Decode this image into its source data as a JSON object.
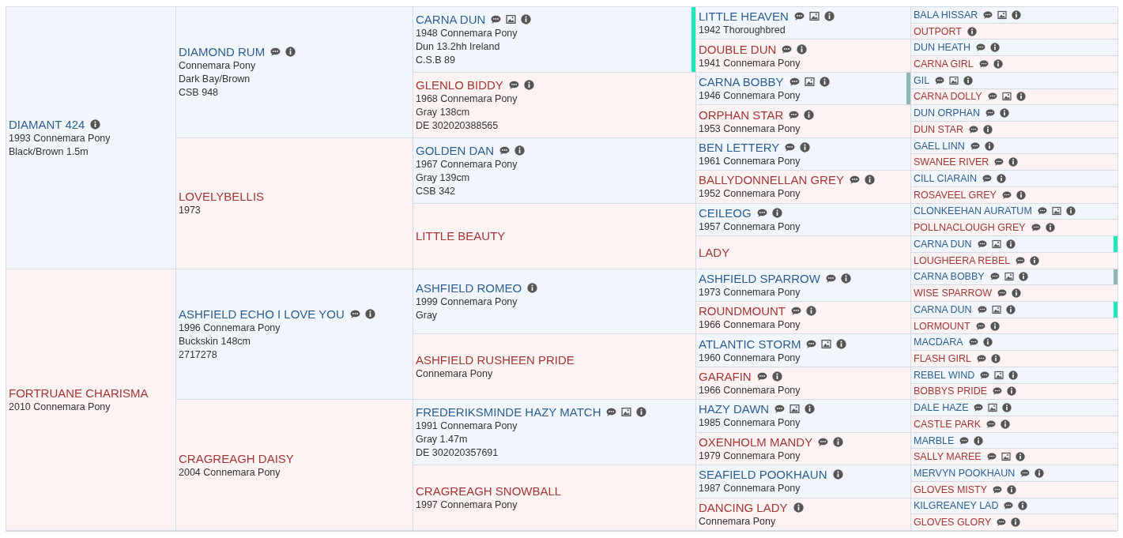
{
  "pedigree": [
    {
      "name": "DIAMANT 424",
      "kind": "sire",
      "details": [
        "1993 Connemara Pony",
        "Black/Brown 1.5m"
      ],
      "comment": false,
      "photo": false,
      "info": true,
      "parents": [
        {
          "name": "DIAMOND RUM",
          "kind": "sire",
          "details": [
            "Connemara Pony",
            "Dark Bay/Brown",
            "CSB 948"
          ],
          "comment": true,
          "photo": false,
          "info": true,
          "parents": [
            {
              "name": "CARNA DUN",
              "kind": "sire",
              "details": [
                "1948 Connemara Pony",
                "Dun 13.2hh Ireland",
                "C.S.B 89"
              ],
              "comment": true,
              "photo": true,
              "info": true,
              "color": "#1de9b6",
              "parents": [
                {
                  "name": "LITTLE HEAVEN",
                  "kind": "sire",
                  "details": [
                    "1942 Thoroughbred"
                  ],
                  "comment": true,
                  "photo": true,
                  "info": true,
                  "parents": [
                    {
                      "name": "BALA HISSAR",
                      "kind": "sire",
                      "comment": true,
                      "photo": true,
                      "info": true
                    },
                    {
                      "name": "OUTPORT",
                      "kind": "dam",
                      "comment": false,
                      "photo": false,
                      "info": true
                    }
                  ]
                },
                {
                  "name": "DOUBLE DUN",
                  "kind": "dam",
                  "details": [
                    "1941 Connemara Pony"
                  ],
                  "comment": true,
                  "photo": false,
                  "info": true,
                  "parents": [
                    {
                      "name": "DUN HEATH",
                      "kind": "sire",
                      "comment": true,
                      "photo": false,
                      "info": true
                    },
                    {
                      "name": "CARNA GIRL",
                      "kind": "dam",
                      "comment": true,
                      "photo": false,
                      "info": true
                    }
                  ]
                }
              ]
            },
            {
              "name": "GLENLO BIDDY",
              "kind": "dam",
              "details": [
                "1968 Connemara Pony",
                "Gray 138cm",
                "DE 302020388565"
              ],
              "comment": true,
              "photo": false,
              "info": true,
              "parents": [
                {
                  "name": "CARNA BOBBY",
                  "kind": "sire",
                  "details": [
                    "1946 Connemara Pony"
                  ],
                  "comment": true,
                  "photo": true,
                  "info": true,
                  "color": "#8fb9b9",
                  "parents": [
                    {
                      "name": "GIL",
                      "kind": "sire",
                      "comment": true,
                      "photo": true,
                      "info": true
                    },
                    {
                      "name": "CARNA DOLLY",
                      "kind": "dam",
                      "comment": true,
                      "photo": true,
                      "info": true
                    }
                  ]
                },
                {
                  "name": "ORPHAN STAR",
                  "kind": "dam",
                  "details": [
                    "1953 Connemara Pony"
                  ],
                  "comment": true,
                  "photo": false,
                  "info": true,
                  "parents": [
                    {
                      "name": "DUN ORPHAN",
                      "kind": "sire",
                      "comment": true,
                      "photo": false,
                      "info": true
                    },
                    {
                      "name": "DUN STAR",
                      "kind": "dam",
                      "comment": true,
                      "photo": false,
                      "info": true
                    }
                  ]
                }
              ]
            }
          ]
        },
        {
          "name": "LOVELYBELLIS",
          "kind": "dam",
          "details": [
            "1973"
          ],
          "comment": false,
          "photo": false,
          "info": false,
          "parents": [
            {
              "name": "GOLDEN DAN",
              "kind": "sire",
              "details": [
                "1967 Connemara Pony",
                "Gray 139cm",
                "CSB 342"
              ],
              "comment": true,
              "photo": false,
              "info": true,
              "parents": [
                {
                  "name": "BEN LETTERY",
                  "kind": "sire",
                  "details": [
                    "1961 Connemara Pony"
                  ],
                  "comment": true,
                  "photo": false,
                  "info": true,
                  "parents": [
                    {
                      "name": "GAEL LINN",
                      "kind": "sire",
                      "comment": true,
                      "photo": false,
                      "info": true
                    },
                    {
                      "name": "SWANEE RIVER",
                      "kind": "dam",
                      "comment": true,
                      "photo": false,
                      "info": true
                    }
                  ]
                },
                {
                  "name": "BALLYDONNELLAN GREY",
                  "kind": "dam",
                  "details": [
                    "1952 Connemara Pony"
                  ],
                  "comment": true,
                  "photo": false,
                  "info": true,
                  "parents": [
                    {
                      "name": "CILL CIARAIN",
                      "kind": "sire",
                      "comment": true,
                      "photo": false,
                      "info": true
                    },
                    {
                      "name": "ROSAVEEL GREY",
                      "kind": "dam",
                      "comment": true,
                      "photo": false,
                      "info": true
                    }
                  ]
                }
              ]
            },
            {
              "name": "LITTLE BEAUTY",
              "kind": "dam",
              "comment": false,
              "photo": false,
              "info": false,
              "parents": [
                {
                  "name": "CEILEOG",
                  "kind": "sire",
                  "details": [
                    "1957 Connemara Pony"
                  ],
                  "comment": true,
                  "photo": false,
                  "info": true,
                  "parents": [
                    {
                      "name": "CLONKEEHAN AURATUM",
                      "kind": "sire",
                      "comment": true,
                      "photo": true,
                      "info": true
                    },
                    {
                      "name": "POLLNACLOUGH GREY",
                      "kind": "dam",
                      "comment": true,
                      "photo": false,
                      "info": true
                    }
                  ]
                },
                {
                  "name": "LADY",
                  "kind": "dam",
                  "comment": false,
                  "photo": false,
                  "info": false,
                  "parents": [
                    {
                      "name": "CARNA DUN",
                      "kind": "sire",
                      "comment": true,
                      "photo": true,
                      "info": true,
                      "color": "#1de9b6"
                    },
                    {
                      "name": "LOUGHEERA REBEL",
                      "kind": "dam",
                      "comment": true,
                      "photo": false,
                      "info": true
                    }
                  ]
                }
              ]
            }
          ]
        }
      ]
    },
    {
      "name": "FORTRUANE CHARISMA",
      "kind": "dam",
      "details": [
        "2010 Connemara Pony"
      ],
      "comment": false,
      "photo": false,
      "info": false,
      "parents": [
        {
          "name": "ASHFIELD ECHO I LOVE YOU",
          "kind": "sire",
          "details": [
            "1996 Connemara Pony",
            "Buckskin 148cm",
            "2717278"
          ],
          "comment": true,
          "photo": false,
          "info": true,
          "parents": [
            {
              "name": "ASHFIELD ROMEO",
              "kind": "sire",
              "details": [
                "1999 Connemara Pony",
                "Gray"
              ],
              "comment": false,
              "photo": false,
              "info": true,
              "parents": [
                {
                  "name": "ASHFIELD SPARROW",
                  "kind": "sire",
                  "details": [
                    "1973 Connemara Pony"
                  ],
                  "comment": true,
                  "photo": false,
                  "info": true,
                  "parents": [
                    {
                      "name": "CARNA BOBBY",
                      "kind": "sire",
                      "comment": true,
                      "photo": true,
                      "info": true,
                      "color": "#8fb9b9"
                    },
                    {
                      "name": "WISE SPARROW",
                      "kind": "dam",
                      "comment": true,
                      "photo": false,
                      "info": true
                    }
                  ]
                },
                {
                  "name": "ROUNDMOUNT",
                  "kind": "dam",
                  "details": [
                    "1966 Connemara Pony"
                  ],
                  "comment": true,
                  "photo": false,
                  "info": true,
                  "parents": [
                    {
                      "name": "CARNA DUN",
                      "kind": "sire",
                      "comment": true,
                      "photo": true,
                      "info": true,
                      "color": "#1de9b6"
                    },
                    {
                      "name": "LORMOUNT",
                      "kind": "dam",
                      "comment": true,
                      "photo": false,
                      "info": true
                    }
                  ]
                }
              ]
            },
            {
              "name": "ASHFIELD RUSHEEN PRIDE",
              "kind": "dam",
              "details": [
                "Connemara Pony"
              ],
              "comment": false,
              "photo": false,
              "info": false,
              "parents": [
                {
                  "name": "ATLANTIC STORM",
                  "kind": "sire",
                  "details": [
                    "1960 Connemara Pony"
                  ],
                  "comment": true,
                  "photo": true,
                  "info": true,
                  "parents": [
                    {
                      "name": "MACDARA",
                      "kind": "sire",
                      "comment": true,
                      "photo": false,
                      "info": true
                    },
                    {
                      "name": "FLASH GIRL",
                      "kind": "dam",
                      "comment": true,
                      "photo": false,
                      "info": true
                    }
                  ]
                },
                {
                  "name": "GARAFIN",
                  "kind": "dam",
                  "details": [
                    "1966 Connemara Pony"
                  ],
                  "comment": true,
                  "photo": false,
                  "info": true,
                  "parents": [
                    {
                      "name": "REBEL WIND",
                      "kind": "sire",
                      "comment": true,
                      "photo": true,
                      "info": true
                    },
                    {
                      "name": "BOBBYS PRIDE",
                      "kind": "dam",
                      "comment": true,
                      "photo": false,
                      "info": true
                    }
                  ]
                }
              ]
            }
          ]
        },
        {
          "name": "CRAGREAGH DAISY",
          "kind": "dam",
          "details": [
            "2004 Connemara Pony"
          ],
          "comment": false,
          "photo": false,
          "info": false,
          "parents": [
            {
              "name": "FREDERIKSMINDE HAZY MATCH",
              "kind": "sire",
              "details": [
                "1991 Connemara Pony",
                "Gray 1.47m",
                "DE 302020357691"
              ],
              "comment": true,
              "photo": true,
              "info": true,
              "parents": [
                {
                  "name": "HAZY DAWN",
                  "kind": "sire",
                  "details": [
                    "1985 Connemara Pony"
                  ],
                  "comment": true,
                  "photo": true,
                  "info": true,
                  "parents": [
                    {
                      "name": "DALE HAZE",
                      "kind": "sire",
                      "comment": true,
                      "photo": true,
                      "info": true
                    },
                    {
                      "name": "CASTLE PARK",
                      "kind": "dam",
                      "comment": true,
                      "photo": false,
                      "info": true
                    }
                  ]
                },
                {
                  "name": "OXENHOLM MANDY",
                  "kind": "dam",
                  "details": [
                    "1979 Connemara Pony"
                  ],
                  "comment": true,
                  "photo": false,
                  "info": true,
                  "parents": [
                    {
                      "name": "MARBLE",
                      "kind": "sire",
                      "comment": true,
                      "photo": false,
                      "info": true
                    },
                    {
                      "name": "SALLY MAREE",
                      "kind": "dam",
                      "comment": true,
                      "photo": true,
                      "info": true
                    }
                  ]
                }
              ]
            },
            {
              "name": "CRAGREAGH SNOWBALL",
              "kind": "dam",
              "details": [
                "1997 Connemara Pony"
              ],
              "comment": false,
              "photo": false,
              "info": false,
              "parents": [
                {
                  "name": "SEAFIELD POOKHAUN",
                  "kind": "sire",
                  "details": [
                    "1987 Connemara Pony"
                  ],
                  "comment": false,
                  "photo": false,
                  "info": true,
                  "parents": [
                    {
                      "name": "MERVYN POOKHAUN",
                      "kind": "sire",
                      "comment": true,
                      "photo": false,
                      "info": true
                    },
                    {
                      "name": "GLOVES MISTY",
                      "kind": "dam",
                      "comment": true,
                      "photo": false,
                      "info": true
                    }
                  ]
                },
                {
                  "name": "DANCING LADY",
                  "kind": "dam",
                  "details": [
                    "Connemara Pony"
                  ],
                  "comment": false,
                  "photo": false,
                  "info": true,
                  "parents": [
                    {
                      "name": "KILGREANEY LAD",
                      "kind": "sire",
                      "comment": true,
                      "photo": false,
                      "info": true
                    },
                    {
                      "name": "GLOVES GLORY",
                      "kind": "dam",
                      "comment": true,
                      "photo": false,
                      "info": true
                    }
                  ]
                }
              ]
            }
          ]
        }
      ]
    }
  ]
}
